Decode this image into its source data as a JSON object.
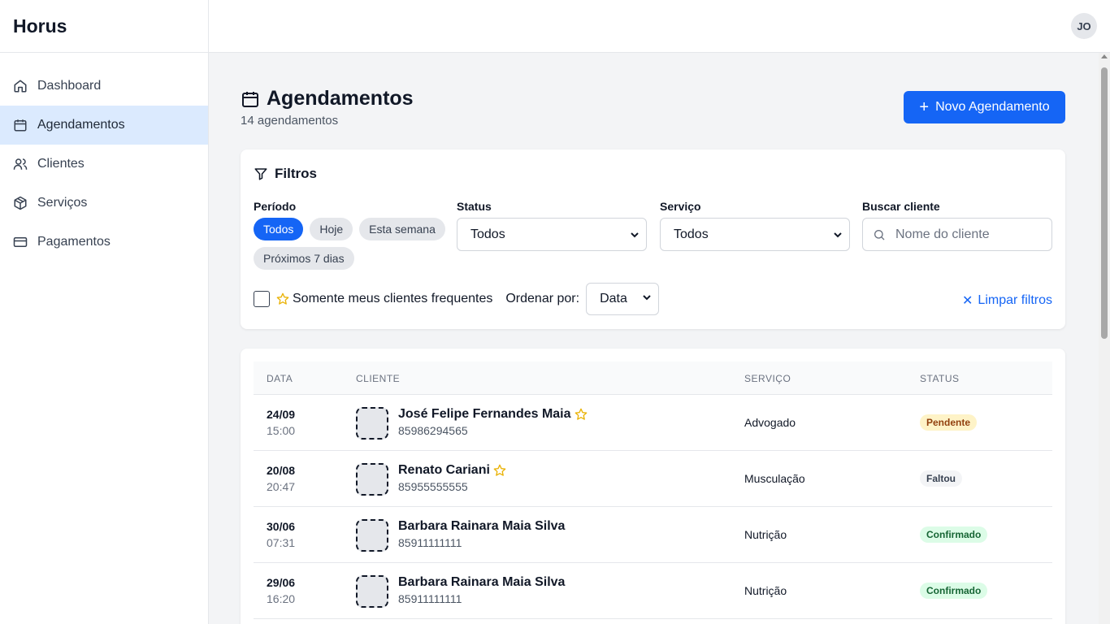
{
  "brand": "Horus",
  "user_initials": "JO",
  "sidebar": {
    "items": [
      {
        "label": "Dashboard",
        "icon": "home-icon"
      },
      {
        "label": "Agendamentos",
        "icon": "calendar-icon",
        "active": true
      },
      {
        "label": "Clientes",
        "icon": "users-icon"
      },
      {
        "label": "Serviços",
        "icon": "package-icon"
      },
      {
        "label": "Pagamentos",
        "icon": "credit-card-icon"
      }
    ]
  },
  "page": {
    "title": "Agendamentos",
    "subtitle": "14 agendamentos",
    "new_button": "Novo Agendamento"
  },
  "filters": {
    "title": "Filtros",
    "period_label": "Período",
    "period_chips": [
      "Todos",
      "Hoje",
      "Esta semana",
      "Próximos 7 dias"
    ],
    "period_selected": "Todos",
    "status_label": "Status",
    "status_value": "Todos",
    "service_label": "Serviço",
    "service_value": "Todos",
    "search_label": "Buscar cliente",
    "search_placeholder": "Nome do cliente",
    "frequent_label": "Somente meus clientes frequentes",
    "order_label": "Ordenar por:",
    "order_value": "Data",
    "clear_label": "Limpar filtros"
  },
  "table": {
    "headers": {
      "date": "DATA",
      "client": "CLIENTE",
      "service": "SERVIÇO",
      "status": "STATUS"
    },
    "rows": [
      {
        "date": "24/09",
        "time": "15:00",
        "name": "José Felipe Fernandes Maia",
        "phone": "85986294565",
        "frequent": true,
        "service": "Advogado",
        "status": "Pendente"
      },
      {
        "date": "20/08",
        "time": "20:47",
        "name": "Renato Cariani",
        "phone": "85955555555",
        "frequent": true,
        "service": "Musculação",
        "status": "Faltou"
      },
      {
        "date": "30/06",
        "time": "07:31",
        "name": "Barbara Rainara Maia Silva",
        "phone": "85911111111",
        "frequent": false,
        "service": "Nutrição",
        "status": "Confirmado"
      },
      {
        "date": "29/06",
        "time": "16:20",
        "name": "Barbara Rainara Maia Silva",
        "phone": "85911111111",
        "frequent": false,
        "service": "Nutrição",
        "status": "Confirmado"
      }
    ]
  },
  "colors": {
    "primary": "#1565f5",
    "star": "#eab308",
    "pendente_bg": "#fef3c7",
    "pendente_fg": "#92400e",
    "faltou_bg": "#f3f4f6",
    "faltou_fg": "#374151",
    "confirmado_bg": "#dcfce7",
    "confirmado_fg": "#166534"
  }
}
